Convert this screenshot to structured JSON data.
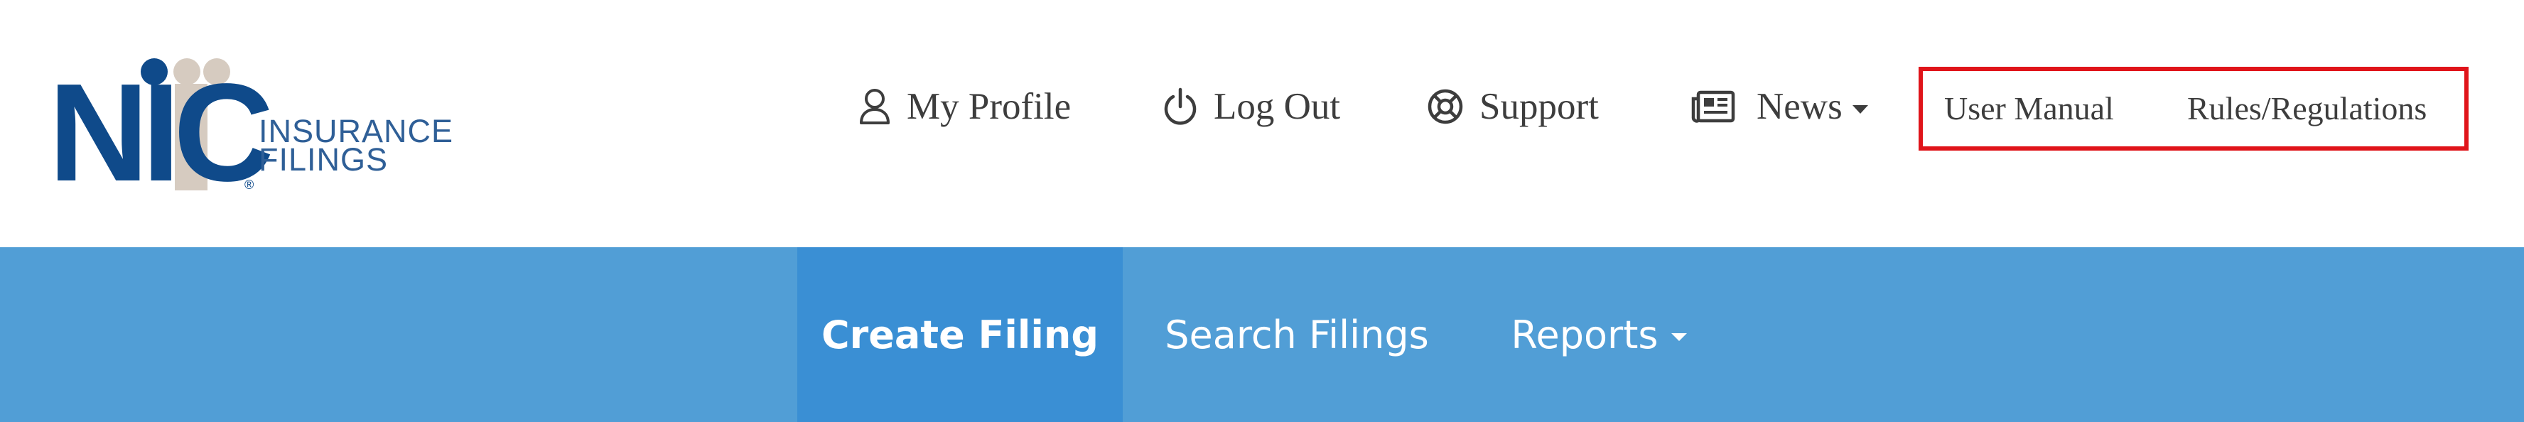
{
  "logo": {
    "mark": "NIC",
    "line1": "INSURANCE",
    "line2": "FILINGS",
    "registered": "®",
    "colors": {
      "navy": "#0f4a8a",
      "tan": "#d6cbc0",
      "text": "#2f5f97"
    }
  },
  "utility_nav": {
    "profile": {
      "label": "My Profile",
      "icon": "user-icon"
    },
    "logout": {
      "label": "Log Out",
      "icon": "power-icon"
    },
    "support": {
      "label": "Support",
      "icon": "lifebuoy-icon"
    },
    "news": {
      "label": "News",
      "icon": "newspaper-icon",
      "has_dropdown": true
    }
  },
  "highlighted_links": {
    "user_manual": "User Manual",
    "rules": "Rules/Regulations",
    "highlight_color": "#e0141a"
  },
  "main_nav": {
    "items": [
      {
        "label": "Create Filing",
        "active": true
      },
      {
        "label": "Search Filings",
        "active": false
      },
      {
        "label": "Reports",
        "active": false,
        "has_dropdown": true
      }
    ],
    "bar_color": "#519ed6",
    "active_color": "#3a8fd4"
  }
}
